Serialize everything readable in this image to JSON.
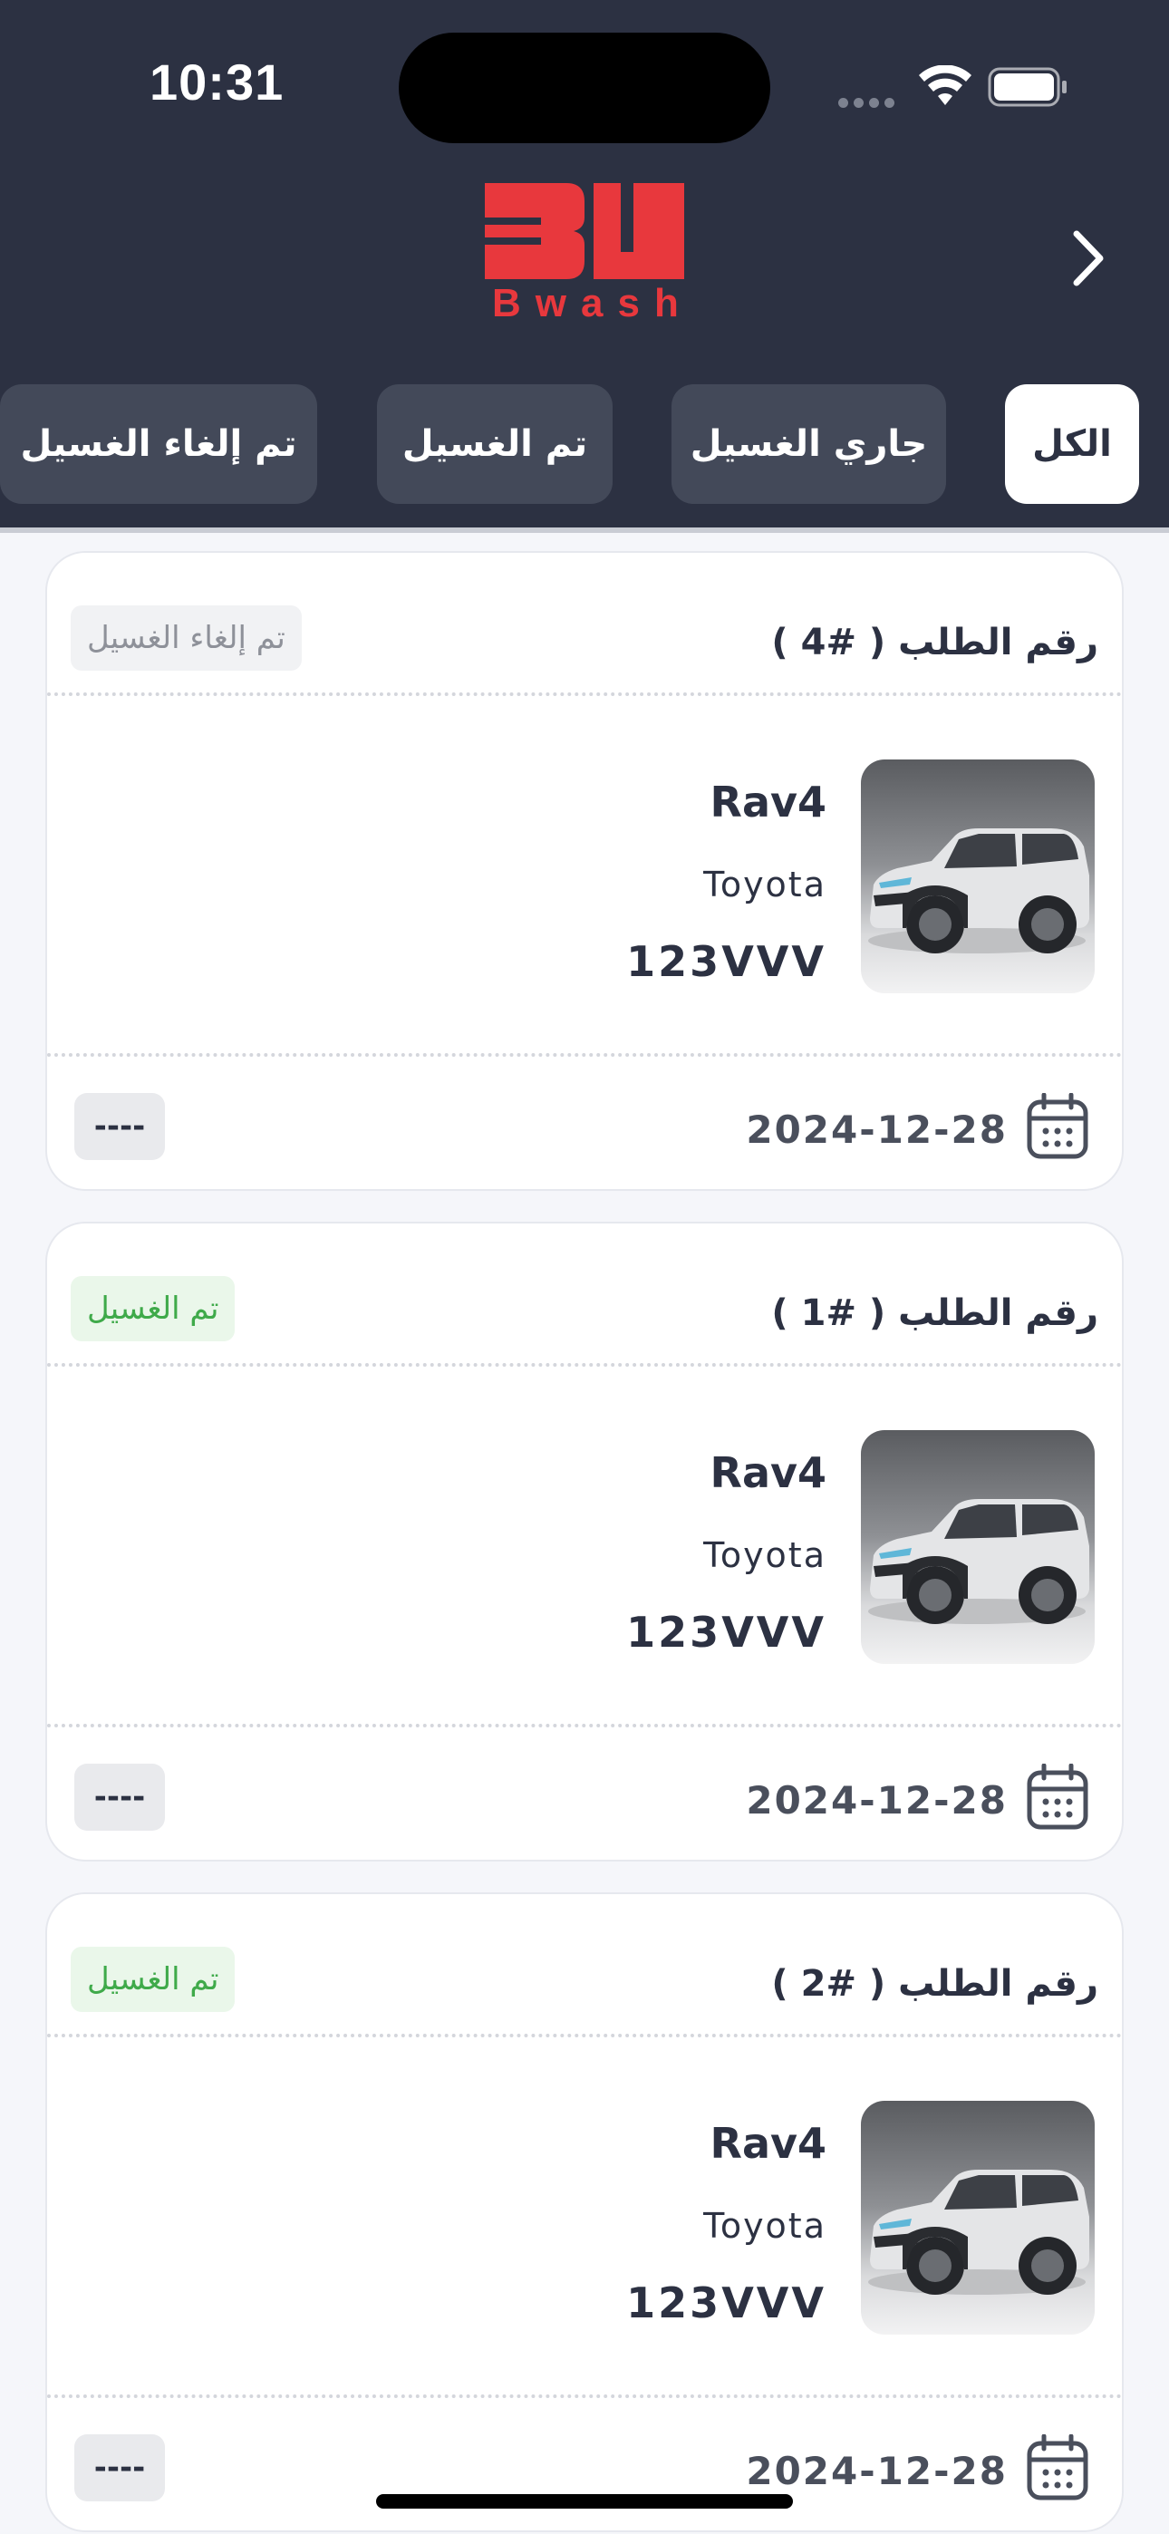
{
  "status_bar": {
    "time": "10:31"
  },
  "header": {
    "logo_text": "Bwash",
    "brand_color": "#e8383d",
    "back_icon": "chevron-right-icon"
  },
  "tabs": [
    {
      "label": "الكل",
      "active": true
    },
    {
      "label": "جاري الغسيل",
      "active": false
    },
    {
      "label": "تم الغسيل",
      "active": false
    },
    {
      "label": "تم إلغاء الغسيل",
      "active": false
    }
  ],
  "orders": [
    {
      "title": "رقم الطلب ( #4 )",
      "status": "تم إلغاء الغسيل",
      "status_color": "#8e9199",
      "status_bg": "#f1f2f4",
      "model": "Rav4",
      "make": "Toyota",
      "plate": "123VVV",
      "date": "2024-12-28",
      "price": "----"
    },
    {
      "title": "رقم الطلب ( #1 )",
      "status": "تم الغسيل",
      "status_color": "#3faa4a",
      "status_bg": "#eaf7ea",
      "model": "Rav4",
      "make": "Toyota",
      "plate": "123VVV",
      "date": "2024-12-28",
      "price": "----"
    },
    {
      "title": "رقم الطلب ( #2 )",
      "status": "تم الغسيل",
      "status_color": "#3faa4a",
      "status_bg": "#eaf7ea",
      "model": "Rav4",
      "make": "Toyota",
      "plate": "123VVV",
      "date": "2024-12-28",
      "price": "----"
    }
  ]
}
